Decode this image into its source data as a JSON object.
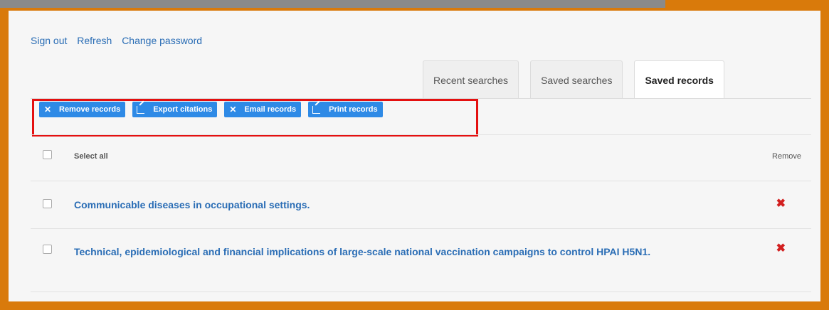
{
  "top_links": [
    "Sign out",
    "Refresh",
    "Change password"
  ],
  "tabs": [
    {
      "label": "Recent searches",
      "active": false
    },
    {
      "label": "Saved searches",
      "active": false
    },
    {
      "label": "Saved records",
      "active": true
    }
  ],
  "actions": [
    {
      "label": "Remove records",
      "icon": "close-icon"
    },
    {
      "label": "Export citations",
      "icon": "external-link-icon"
    },
    {
      "label": "Email records",
      "icon": "close-icon"
    },
    {
      "label": "Print records",
      "icon": "external-link-icon"
    }
  ],
  "table": {
    "select_all_label": "Select all",
    "remove_header": "Remove",
    "records": [
      {
        "title": "Communicable diseases in occupational settings."
      },
      {
        "title": "Technical, epidemiological and financial implications of large-scale national vaccination campaigns to control HPAI H5N1."
      }
    ]
  },
  "colors": {
    "accent": "#2e8ae6",
    "link": "#2a6db5",
    "frame": "#d97a0b",
    "highlight": "#e41010",
    "remove": "#d21f1f"
  }
}
